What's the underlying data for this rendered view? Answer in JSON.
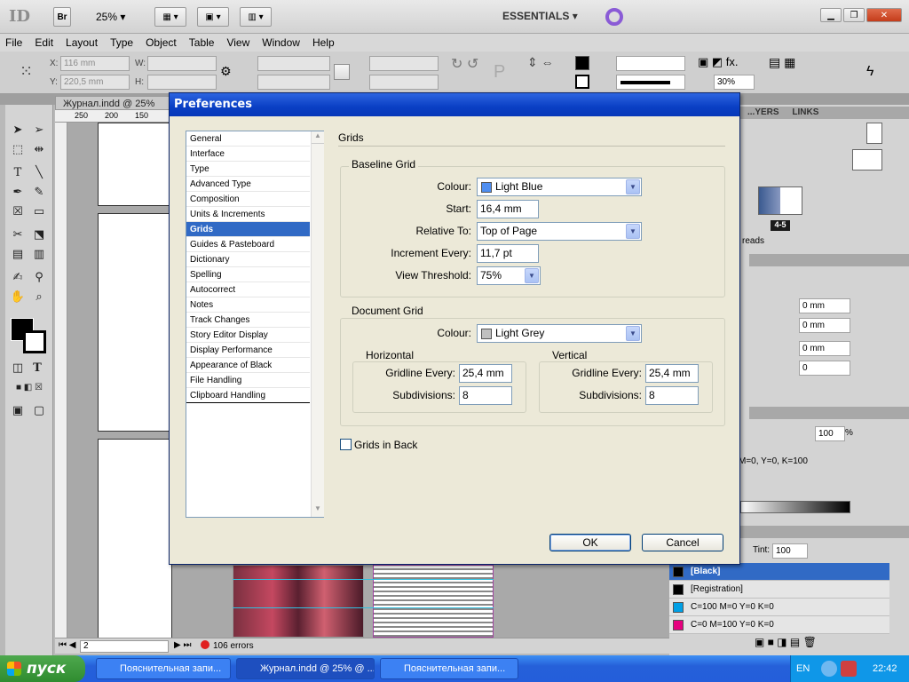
{
  "app": {
    "logo": "ID",
    "bridge": "Br",
    "zoom": "25%",
    "workspace": "ESSENTIALS"
  },
  "menu": [
    "File",
    "Edit",
    "Layout",
    "Type",
    "Object",
    "Table",
    "View",
    "Window",
    "Help"
  ],
  "control": {
    "x_label": "X:",
    "x_value": "116 mm",
    "y_label": "Y:",
    "y_value": "220,5 mm",
    "w_label": "W:",
    "h_label": "H:",
    "opacity": "30%"
  },
  "document": {
    "tab": "Журнал.indd @ 25%",
    "ruler": [
      "250",
      "200",
      "150"
    ],
    "page_field": "2",
    "errors": "106 errors"
  },
  "panels": {
    "layers_tab": "...YERS",
    "links_tab": "LINKS",
    "spread_label": "4-5",
    "spreads_text": "reads",
    "para_fields": [
      "0 mm",
      "0 mm",
      "0 mm",
      "0"
    ],
    "tint_label": "Tint:",
    "tint_value": "100",
    "percent_value": "100",
    "percent": "%",
    "swatch_cmyk": "M=0, Y=0, K=100",
    "swatches": [
      {
        "name": "[Black]",
        "color": "#000000"
      },
      {
        "name": "[Registration]",
        "color": "#000000"
      },
      {
        "name": "C=100 M=0 Y=0 K=0",
        "color": "#00a0e6"
      },
      {
        "name": "C=0 M=100 Y=0 K=0",
        "color": "#e6007e"
      }
    ]
  },
  "dialog": {
    "title": "Preferences",
    "categories": [
      "General",
      "Interface",
      "Type",
      "Advanced Type",
      "Composition",
      "Units & Increments",
      "Grids",
      "Guides & Pasteboard",
      "Dictionary",
      "Spelling",
      "Autocorrect",
      "Notes",
      "Track Changes",
      "Story Editor Display",
      "Display Performance",
      "Appearance of Black",
      "File Handling",
      "Clipboard Handling"
    ],
    "selected_index": 6,
    "section_title": "Grids",
    "baseline": {
      "legend": "Baseline Grid",
      "colour_label": "Colour:",
      "colour_value": "Light Blue",
      "colour_swatch": "#4f8ef0",
      "start_label": "Start:",
      "start_value": "16,4 mm",
      "relative_label": "Relative To:",
      "relative_value": "Top of Page",
      "increment_label": "Increment Every:",
      "increment_value": "11,7 pt",
      "threshold_label": "View Threshold:",
      "threshold_value": "75%"
    },
    "docgrid": {
      "legend": "Document Grid",
      "colour_label": "Colour:",
      "colour_value": "Light Grey",
      "colour_swatch": "#c0c0c0",
      "horizontal": {
        "legend": "Horizontal",
        "gridline_label": "Gridline Every:",
        "gridline_value": "25,4 mm",
        "subdiv_label": "Subdivisions:",
        "subdiv_value": "8"
      },
      "vertical": {
        "legend": "Vertical",
        "gridline_label": "Gridline Every:",
        "gridline_value": "25,4 mm",
        "subdiv_label": "Subdivisions:",
        "subdiv_value": "8"
      }
    },
    "grids_in_back": "Grids in Back",
    "ok": "OK",
    "cancel": "Cancel"
  },
  "taskbar": {
    "start": "пуск",
    "items": [
      "Пояснительная запи...",
      "Журнал.indd @ 25% @ ...",
      "Пояснительная запи..."
    ],
    "lang": "EN",
    "time": "22:42"
  }
}
